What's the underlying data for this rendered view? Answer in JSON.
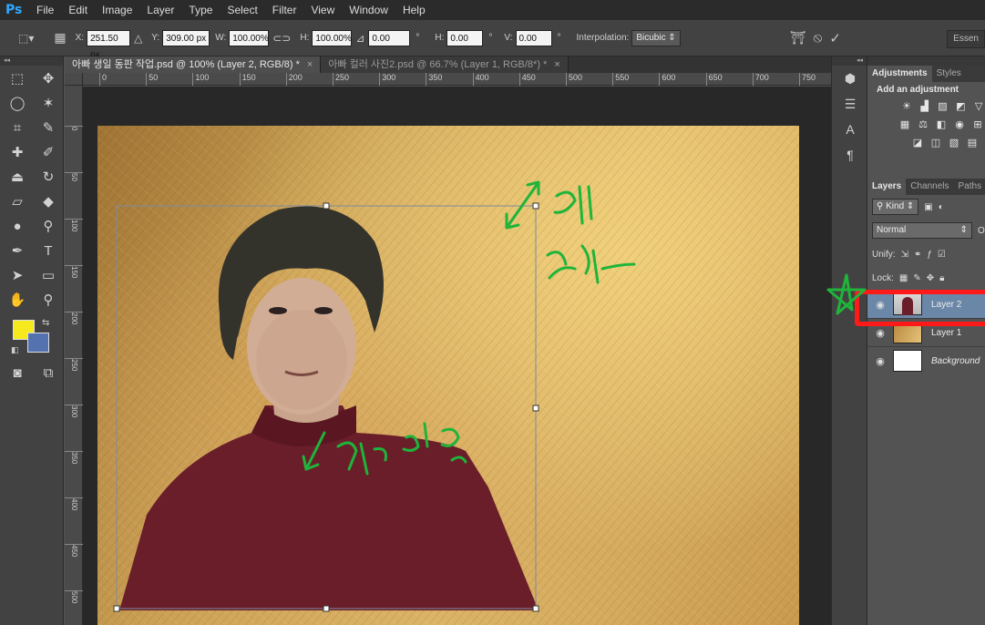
{
  "app": {
    "logo": "Ps"
  },
  "menu": [
    "File",
    "Edit",
    "Image",
    "Layer",
    "Type",
    "Select",
    "Filter",
    "View",
    "Window",
    "Help"
  ],
  "options": {
    "x_label": "X:",
    "x_value": "251.50 px",
    "y_label": "Y:",
    "y_value": "309.00 px",
    "w_label": "W:",
    "w_value": "100.00%",
    "h_label": "H:",
    "h_value": "100.00%",
    "angle_value": "0.00",
    "deg": "°",
    "hskew_label": "H:",
    "hskew_value": "0.00",
    "vskew_label": "V:",
    "vskew_value": "0.00",
    "interp_label": "Interpolation:",
    "interp_value": "Bicubic",
    "workspace": "Essen"
  },
  "tabs": [
    {
      "title": "아빠 생일 동판 작업.psd @ 100% (Layer 2, RGB/8) *",
      "close": "×"
    },
    {
      "title": "아빠 컬러 사진2.psd @ 66.7% (Layer 1, RGB/8*) *",
      "close": "×"
    }
  ],
  "ruler_h": [
    "0",
    "50",
    "100",
    "150",
    "200",
    "250",
    "300",
    "350",
    "400",
    "450",
    "500",
    "550",
    "600",
    "650",
    "700",
    "750"
  ],
  "ruler_v": [
    "0",
    "5 0",
    "1 0 0",
    "1 5 0",
    "2 0 0",
    "2 5 0",
    "3 0 0",
    "3 5 0",
    "4 0 0",
    "4 5 0",
    "5 0 0"
  ],
  "panel": {
    "adjust_tabs": [
      "Adjustments",
      "Styles"
    ],
    "add_adjustment": "Add an adjustment",
    "layer_tabs": [
      "Layers",
      "Channels",
      "Paths"
    ],
    "kind": "Kind",
    "blend_mode": "Normal",
    "opacity_cut": "O",
    "unify_label": "Unify:",
    "lock_label": "Lock:",
    "layers": [
      {
        "name": "Layer 2",
        "selected": true
      },
      {
        "name": "Layer 1",
        "selected": false
      },
      {
        "name": "Background",
        "selected": false
      }
    ]
  },
  "colors": {
    "foreground": "#f6ea1e",
    "background": "#5472b0",
    "annotation": "#1fb43a",
    "highlight": "#ff1a1a"
  }
}
